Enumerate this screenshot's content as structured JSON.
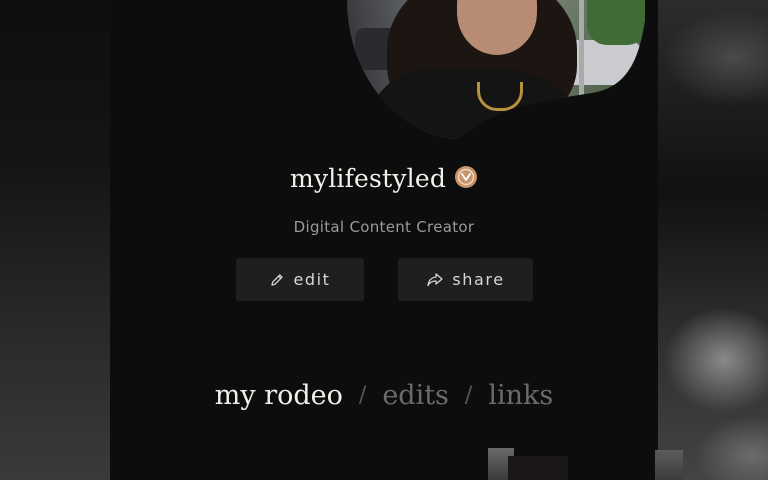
{
  "profile": {
    "username": "mylifestyled",
    "subtitle": "Digital Content Creator",
    "verified_icon": "verified-badge-icon",
    "verified_color": "#c8956a"
  },
  "actions": {
    "edit_label": "edit",
    "edit_icon": "pencil-icon",
    "share_label": "share",
    "share_icon": "share-arrow-icon"
  },
  "tabs": [
    {
      "label": "my rodeo",
      "active": true
    },
    {
      "label": "edits",
      "active": false
    },
    {
      "label": "links",
      "active": false
    }
  ],
  "tab_separator": "/",
  "colors": {
    "background": "#0d0d0d",
    "button_bg": "#1f1f1f",
    "active_tab": "#f2efe8",
    "inactive_tab": "#6b6b6b"
  }
}
